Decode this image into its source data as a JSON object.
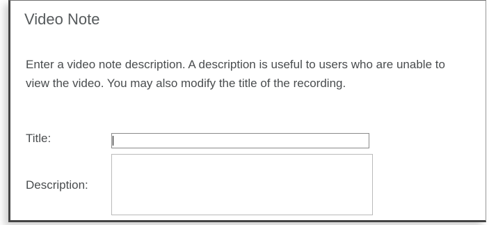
{
  "dialog": {
    "title": "Video Note",
    "instructions": "Enter a video note description. A description is useful to users who are unable to view the video. You may also modify the title of the recording.",
    "fields": {
      "title_label": "Title:",
      "title_value": "",
      "description_label": "Description:",
      "description_value": ""
    }
  }
}
